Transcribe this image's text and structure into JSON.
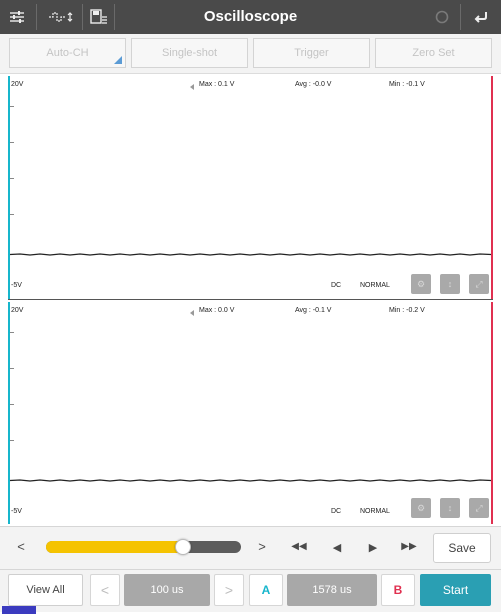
{
  "app": {
    "title": "Oscilloscope"
  },
  "toolbar": {
    "icons": [
      "settings-sliders-icon",
      "waveform-icon",
      "save-file-icon",
      "refresh-icon",
      "back-icon"
    ]
  },
  "functions": {
    "auto_ch": "Auto-CH",
    "single_shot": "Single-shot",
    "trigger": "Trigger",
    "zero_set": "Zero Set"
  },
  "channels": [
    {
      "top_label": "20V",
      "bottom_label": "-5V",
      "max": "Max : 0.1 V",
      "avg": "Avg : -0.0 V",
      "min": "Min : -0.1 V",
      "coupling": "DC",
      "mode": "NORMAL"
    },
    {
      "top_label": "20V",
      "bottom_label": "-5V",
      "max": "Max : 0.0 V",
      "avg": "Avg : -0.1 V",
      "min": "Min : -0.2 V",
      "coupling": "DC",
      "mode": "NORMAL"
    }
  ],
  "controls": {
    "slider_position": 0.7,
    "save_label": "Save",
    "prev": "<",
    "next": ">",
    "fast_back": "◀◀",
    "step_back": "◀",
    "step_forward": "▶",
    "fast_forward": "▶▶"
  },
  "bottom": {
    "view_all": "View All",
    "timebase": "100 us",
    "cursor_a": "A",
    "cursor_delta": "1578 us",
    "cursor_b": "B",
    "start": "Start"
  },
  "colors": {
    "accent": "#2a9fb3",
    "slider_fill": "#f5c300",
    "cursor_a": "#17b6cc",
    "cursor_b": "#e03050"
  }
}
